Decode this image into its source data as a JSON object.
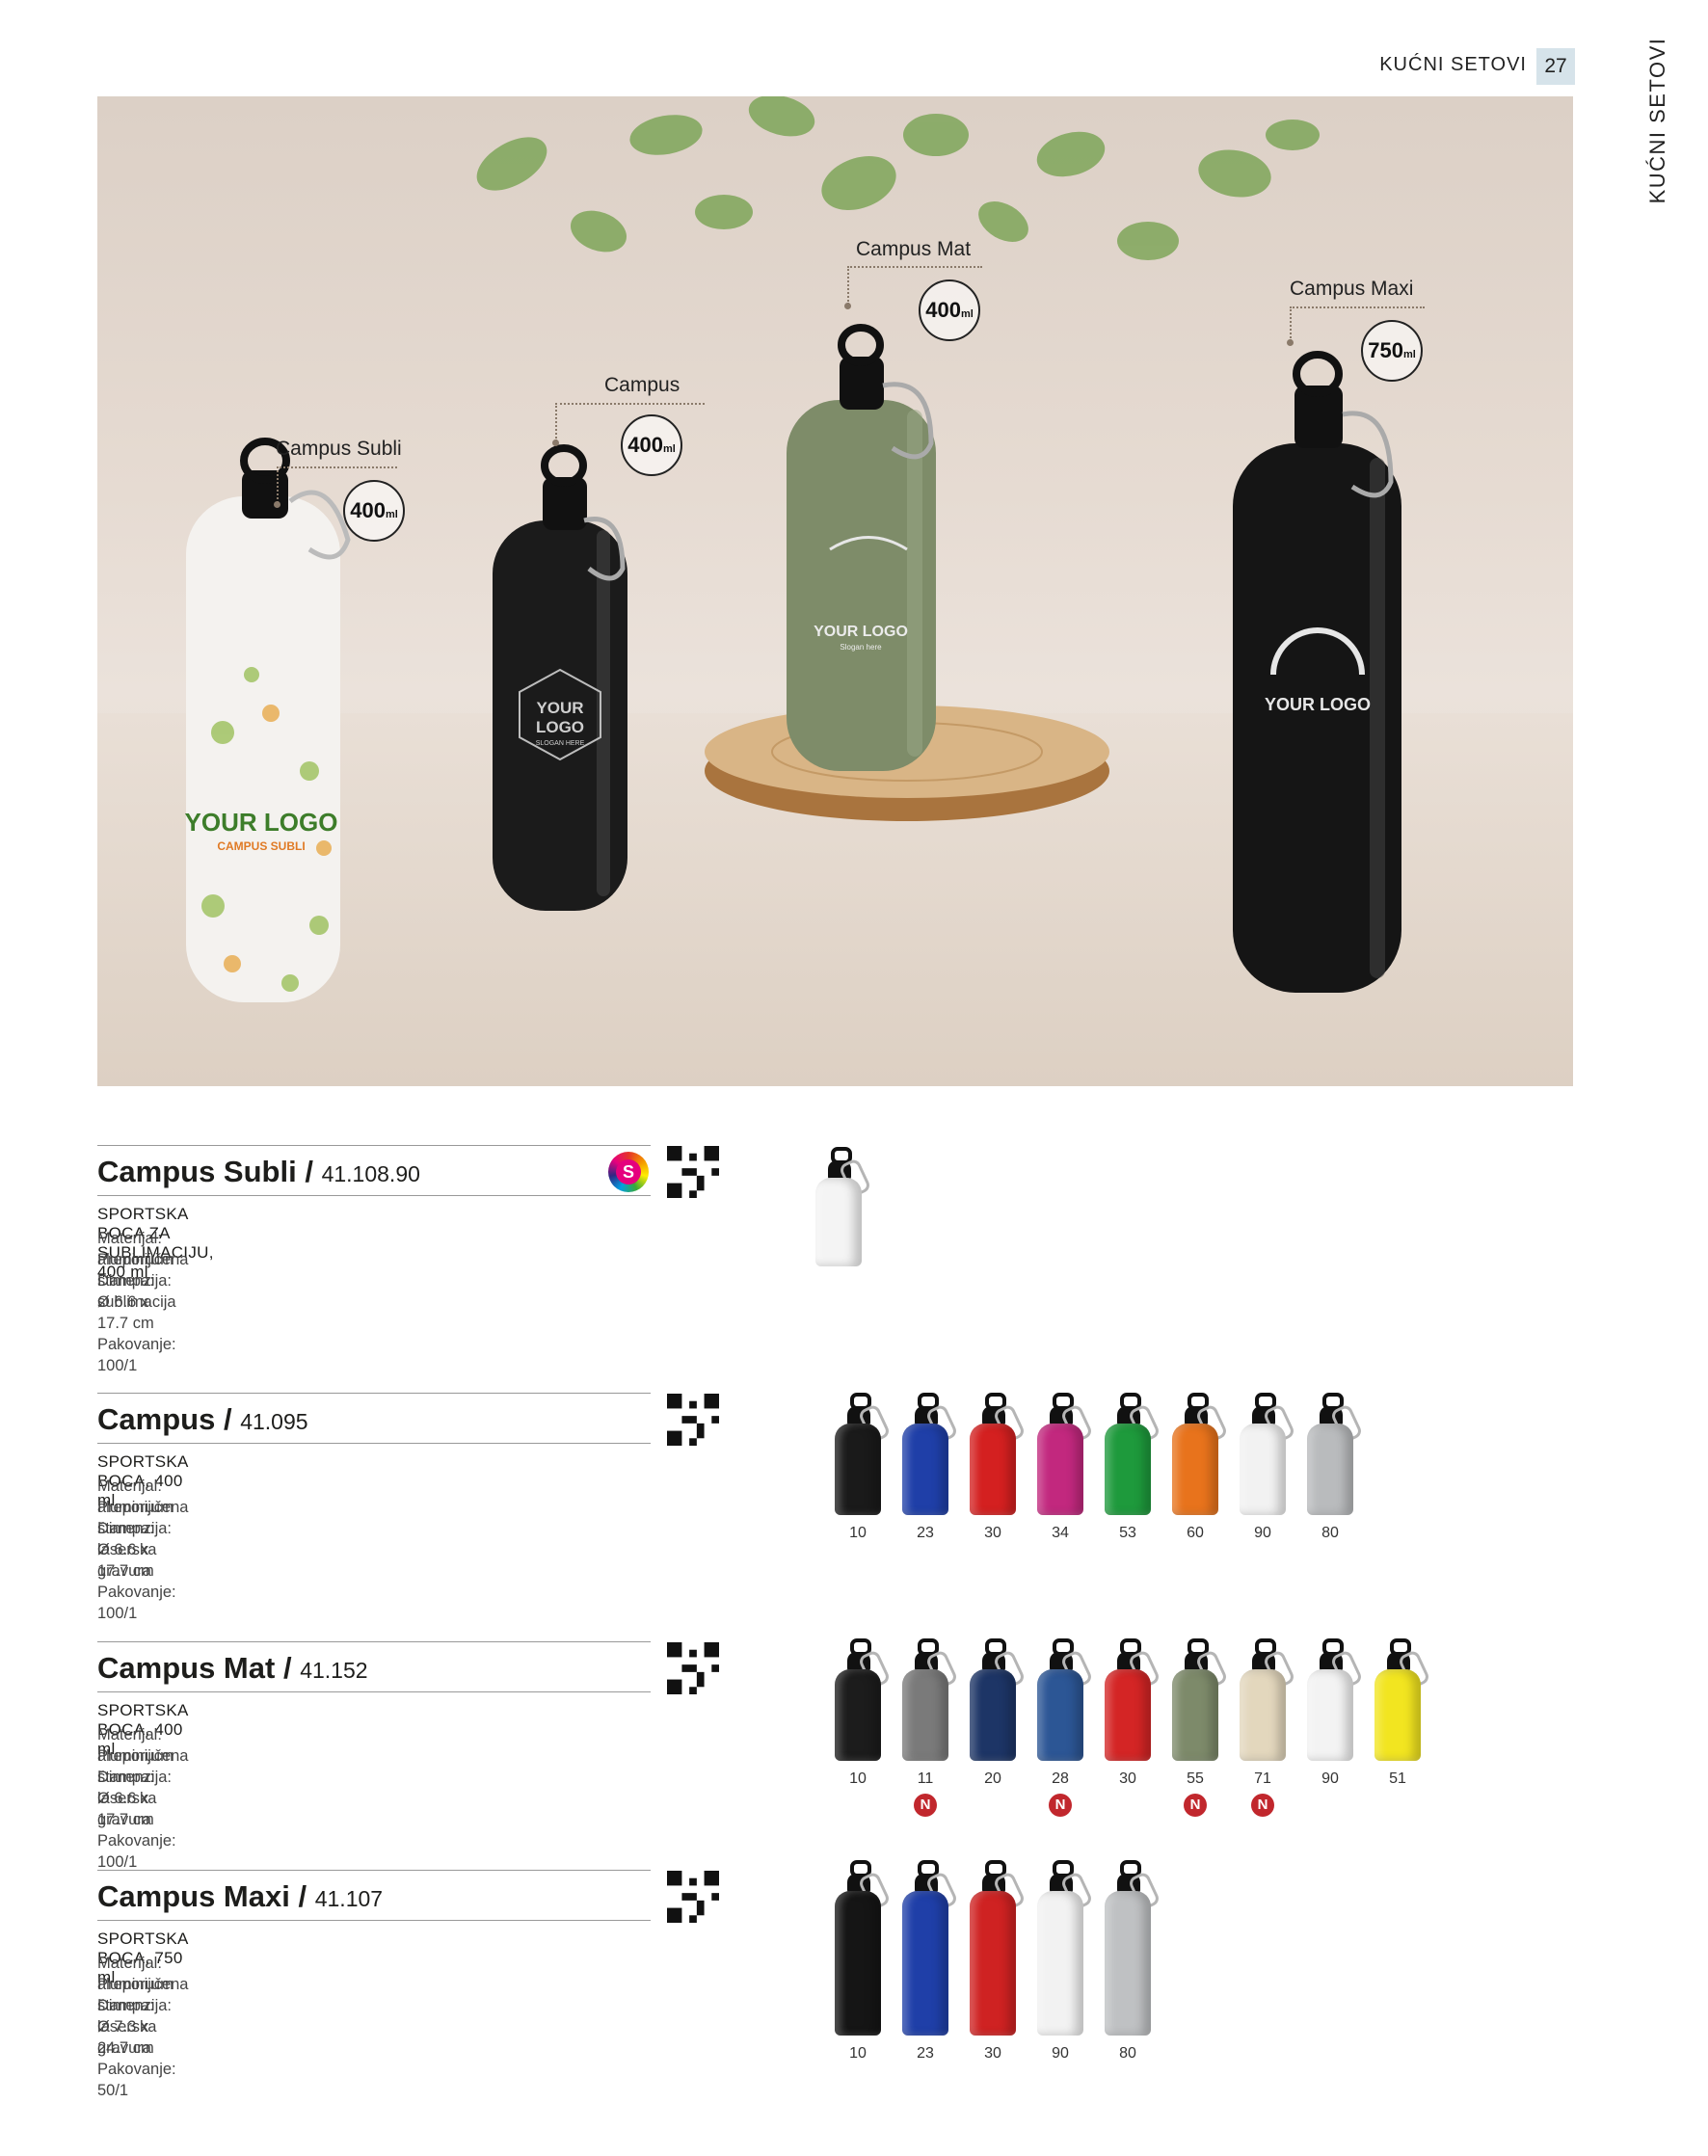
{
  "header": {
    "section_title": "KUĆNI SETOVI",
    "page_number": "27",
    "side_label": "KUĆNI SETOVI"
  },
  "hero": {
    "callouts": [
      {
        "name": "Campus Subli",
        "volume": "400",
        "unit": "ml"
      },
      {
        "name": "Campus",
        "volume": "400",
        "unit": "ml"
      },
      {
        "name": "Campus Mat",
        "volume": "400",
        "unit": "ml"
      },
      {
        "name": "Campus Maxi",
        "volume": "750",
        "unit": "ml"
      }
    ],
    "bottle_prints": {
      "subli": [
        "YOUR LOGO",
        "CAMPUS SUBLI"
      ],
      "campus": [
        "YOUR",
        "LOGO",
        "SLOGAN HERE"
      ],
      "mat": [
        "YOUR LOGO",
        "Slogan here"
      ],
      "maxi": [
        "YOUR LOGO"
      ]
    }
  },
  "products": [
    {
      "name": "Campus Subli",
      "separator": "/",
      "code": "41.108.90",
      "description": "SPORTSKA BOCA ZA SUBLIMACIJU, 400 ml",
      "spec": "Materijal: aluminijum Dimenzija: Ø 6.6 x 17.7 cm Pakovanje: 100/1",
      "print": "Preporučena štampa: sublimacija",
      "sublimation_badge": "S",
      "colors": []
    },
    {
      "name": "Campus",
      "separator": "/",
      "code": "41.095",
      "description": "SPORTSKA BOCA, 400 ml",
      "spec": "Materijal: aluminijum Dimenzija: Ø 6.6 x 17.7 cm Pakovanje: 100/1",
      "print": "Preporučena štampa: laserska gravura",
      "colors": [
        {
          "code": "10",
          "hex": "#1a1a1a"
        },
        {
          "code": "23",
          "hex": "#1f3fa8"
        },
        {
          "code": "30",
          "hex": "#d42020"
        },
        {
          "code": "34",
          "hex": "#c2287e"
        },
        {
          "code": "53",
          "hex": "#1e9a3c"
        },
        {
          "code": "60",
          "hex": "#e8731c"
        },
        {
          "code": "90",
          "hex": "#f2f2f2"
        },
        {
          "code": "80",
          "hex": "#b9bbbd"
        }
      ]
    },
    {
      "name": "Campus Mat",
      "separator": "/",
      "code": "41.152",
      "description": "SPORTSKA BOCA, 400 ml",
      "spec": "Materijal: aluminijum Dimenzija: Ø 6.6 x 17.7 cm Pakovanje: 100/1",
      "print": "Preporučena štampa: laserska gravura",
      "new_label": "N",
      "colors": [
        {
          "code": "10",
          "hex": "#1c1c1c",
          "new": false
        },
        {
          "code": "11",
          "hex": "#7a7a7a",
          "new": true
        },
        {
          "code": "20",
          "hex": "#1d3566",
          "new": false
        },
        {
          "code": "28",
          "hex": "#2c5695",
          "new": true
        },
        {
          "code": "30",
          "hex": "#d42525",
          "new": false
        },
        {
          "code": "55",
          "hex": "#7d8a6a",
          "new": true
        },
        {
          "code": "71",
          "hex": "#e3d7bd",
          "new": true
        },
        {
          "code": "90",
          "hex": "#f3f3f3",
          "new": false
        },
        {
          "code": "51",
          "hex": "#f2e520",
          "new": false
        }
      ]
    },
    {
      "name": "Campus Maxi",
      "separator": "/",
      "code": "41.107",
      "description": "SPORTSKA BOCA, 750 ml",
      "spec": "Materijal: aluminijum Dimenzija: Ø 7.3 x 24.7 cm Pakovanje: 50/1",
      "print": "Preporučena štampa: laserska gravura",
      "colors": [
        {
          "code": "10",
          "hex": "#151515"
        },
        {
          "code": "23",
          "hex": "#1f3fa8"
        },
        {
          "code": "30",
          "hex": "#cf2222"
        },
        {
          "code": "90",
          "hex": "#f2f2f2"
        },
        {
          "code": "80",
          "hex": "#bfc1c3"
        }
      ]
    }
  ]
}
